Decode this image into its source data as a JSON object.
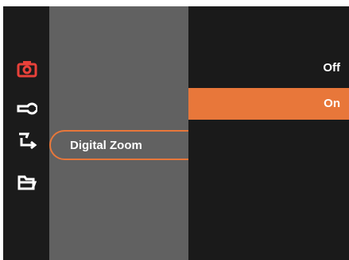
{
  "sidebar": {
    "icons": [
      {
        "name": "camera-icon",
        "active": true
      },
      {
        "name": "wrench-icon",
        "active": false
      },
      {
        "name": "transfer-icon",
        "active": false
      },
      {
        "name": "folder-icon",
        "active": false
      }
    ]
  },
  "menu": {
    "items": [
      {
        "label": "Digital Zoom",
        "selected": true
      }
    ]
  },
  "options": {
    "items": [
      {
        "label": "Off",
        "selected": false
      },
      {
        "label": "On",
        "selected": true
      }
    ]
  },
  "colors": {
    "accent": "#e8773a",
    "active_icon": "#e8413a",
    "icon": "#ffffff",
    "icon_column_bg": "#1b1b1b",
    "menu_column_bg": "#616161",
    "options_column_bg": "#1a1a1a"
  }
}
